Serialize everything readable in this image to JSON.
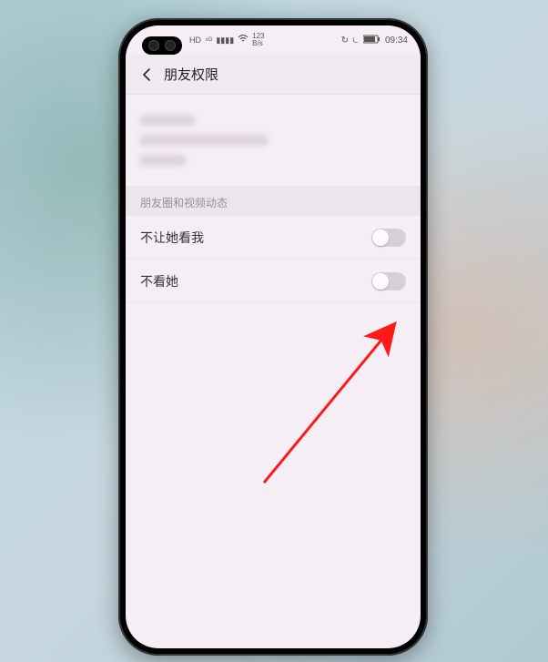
{
  "status": {
    "hd_icon": "HD",
    "signal": "📶",
    "wifi": "📡",
    "speed_top": "123",
    "speed_bot": "B/s",
    "alarm": "⏰",
    "battery": "🔋",
    "batt_pct": "▮▮▯",
    "time": "09:34"
  },
  "header": {
    "title": "朋友权限"
  },
  "section": {
    "moments_video": "朋友圈和视频动态"
  },
  "rows": {
    "hide_my_posts": "不让她看我",
    "hide_her_posts": "不看她"
  },
  "toggles": {
    "hide_my_posts_on": false,
    "hide_her_posts_on": false
  }
}
